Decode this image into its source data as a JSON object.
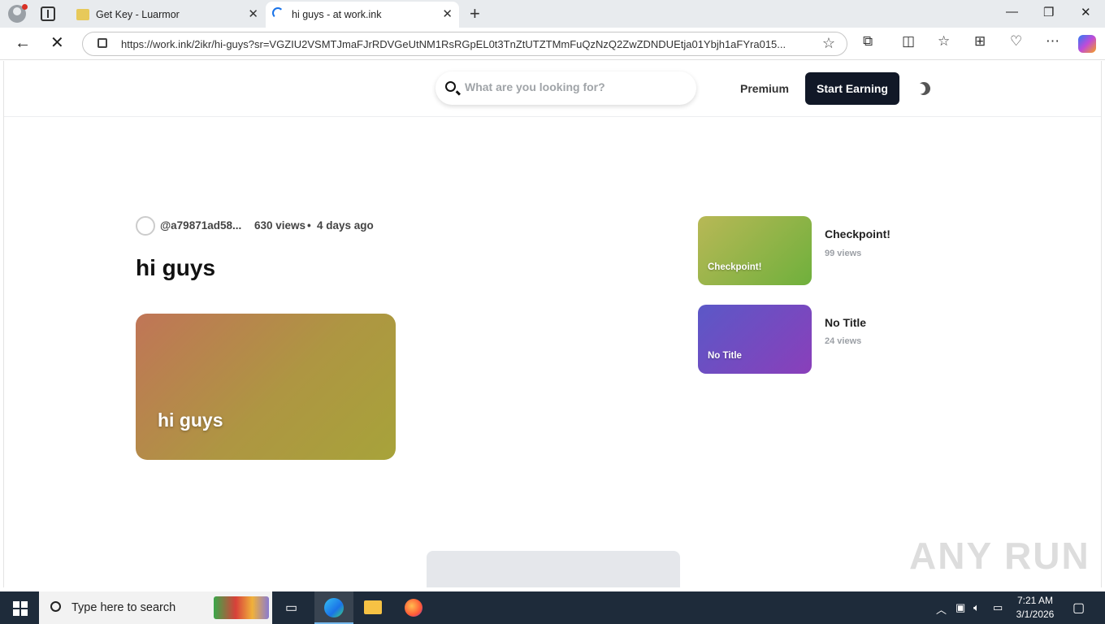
{
  "browser": {
    "tabs": [
      {
        "title": "Get Key - Luarmor",
        "active": false
      },
      {
        "title": "hi guys - at work.ink",
        "active": true
      }
    ],
    "url": "https://work.ink/2ikr/hi-guys?sr=VGZIU2VSMTJmaFJrRDVGeUtNM1RsRGpEL0t3TnZtUTZTMmFuQzNzQ2ZwZDNDUEtja01Ybjh1aFYra015..."
  },
  "site": {
    "search_placeholder": "What are you looking for?",
    "premium_label": "Premium",
    "start_earning_label": "Start Earning"
  },
  "post": {
    "author": "@a79871ad58...",
    "views": "630 views",
    "separator": "•",
    "age": "4 days ago",
    "title": "hi guys",
    "thumbnail_label": "hi guys"
  },
  "related": [
    {
      "thumb_label": "Checkpoint!",
      "title": "Checkpoint!",
      "views": "99 views",
      "color_from": "#b8b856",
      "color_to": "#6fb03c"
    },
    {
      "thumb_label": "No Title",
      "title": "No Title",
      "views": "24 views",
      "color_from": "#5b58c7",
      "color_to": "#8a3fba"
    }
  ],
  "watermark": "ANY RUN",
  "taskbar": {
    "search_placeholder": "Type here to search",
    "time": "7:21 AM",
    "date": "3/1/2026"
  }
}
